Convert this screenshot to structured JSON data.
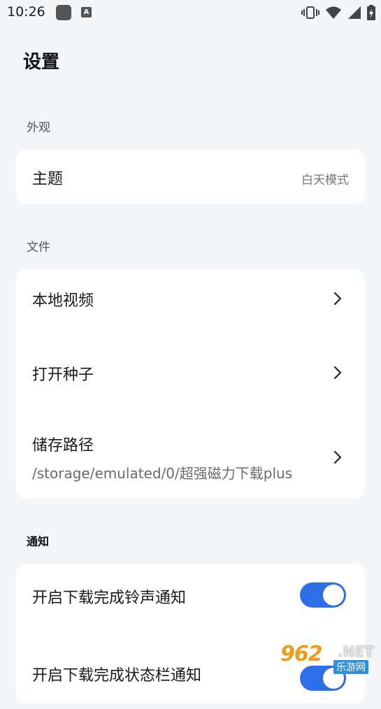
{
  "status_bar": {
    "time": "10:26",
    "app_badge_letter": "A",
    "icons": [
      "vibrate-icon",
      "wifi-icon",
      "signal-icon",
      "battery-charging-icon"
    ]
  },
  "page": {
    "title": "设置"
  },
  "sections": {
    "appearance": {
      "label": "外观",
      "theme": {
        "label": "主题",
        "value": "白天模式"
      }
    },
    "files": {
      "label": "文件",
      "local_video": {
        "label": "本地视频"
      },
      "open_torrent": {
        "label": "打开种子"
      },
      "storage_path": {
        "label": "储存路径",
        "value": "/storage/emulated/0/超强磁力下载plus"
      }
    },
    "notifications": {
      "label": "通知",
      "download_ringtone": {
        "label": "开启下载完成铃声通知",
        "enabled": true
      },
      "download_statusbar": {
        "label": "开启下载完成状态栏通知",
        "enabled": true
      }
    }
  },
  "watermark": {
    "brand": "962",
    "domain": ".NET",
    "subtitle": "乐游网"
  },
  "colors": {
    "accent": "#2d6fe6",
    "background": "#f4f5f7",
    "card": "#ffffff"
  }
}
